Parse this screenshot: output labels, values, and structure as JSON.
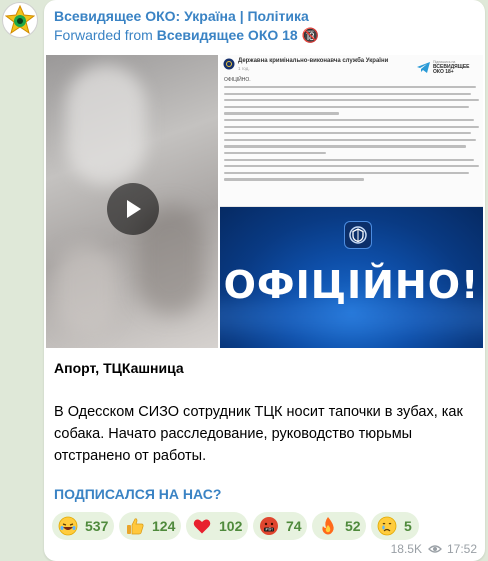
{
  "post": {
    "channel_title": "Всевидящее ОКО: Україна | Політика",
    "forwarded_prefix": "Forwarded from",
    "forwarded_source": "Всевидящее ОКО 18 🔞",
    "title": "Апорт, ТЦКашница",
    "body": "В Одесском СИЗО сотрудник ТЦК носит тапочки в зубах, как собака. Начато расследование, руководство тюрьмы отстранено от работы.",
    "cta": "ПОДПИСАЛСЯ НА НАС?",
    "views": "18.5K",
    "time": "17:52"
  },
  "media": {
    "doc": {
      "org": "Державна кримінально-виконавча служба України",
      "time": "1 год.",
      "heading": "ОФІЦІЙНО.",
      "brand_small": "Підпишись на",
      "brand_line1": "ВСЕВИДЯЩЕЕ",
      "brand_line2": "ОКО 18+"
    },
    "banner_text": "ОФІЦІЙНО!"
  },
  "reactions": [
    {
      "emoji": "rolling-on-floor-laughing",
      "count": "537"
    },
    {
      "emoji": "thumbs-up",
      "count": "124"
    },
    {
      "emoji": "red-heart",
      "count": "102"
    },
    {
      "emoji": "face-with-symbols-on-mouth",
      "count": "74"
    },
    {
      "emoji": "fire",
      "count": "52"
    },
    {
      "emoji": "crying-face",
      "count": "5"
    }
  ],
  "colors": {
    "accent": "#3a83c4",
    "reaction_bg": "#e7f2df",
    "reaction_text": "#4f8a3c",
    "chat_bg": "#dfe8d8",
    "banner_blue": "#0e4fa9"
  }
}
